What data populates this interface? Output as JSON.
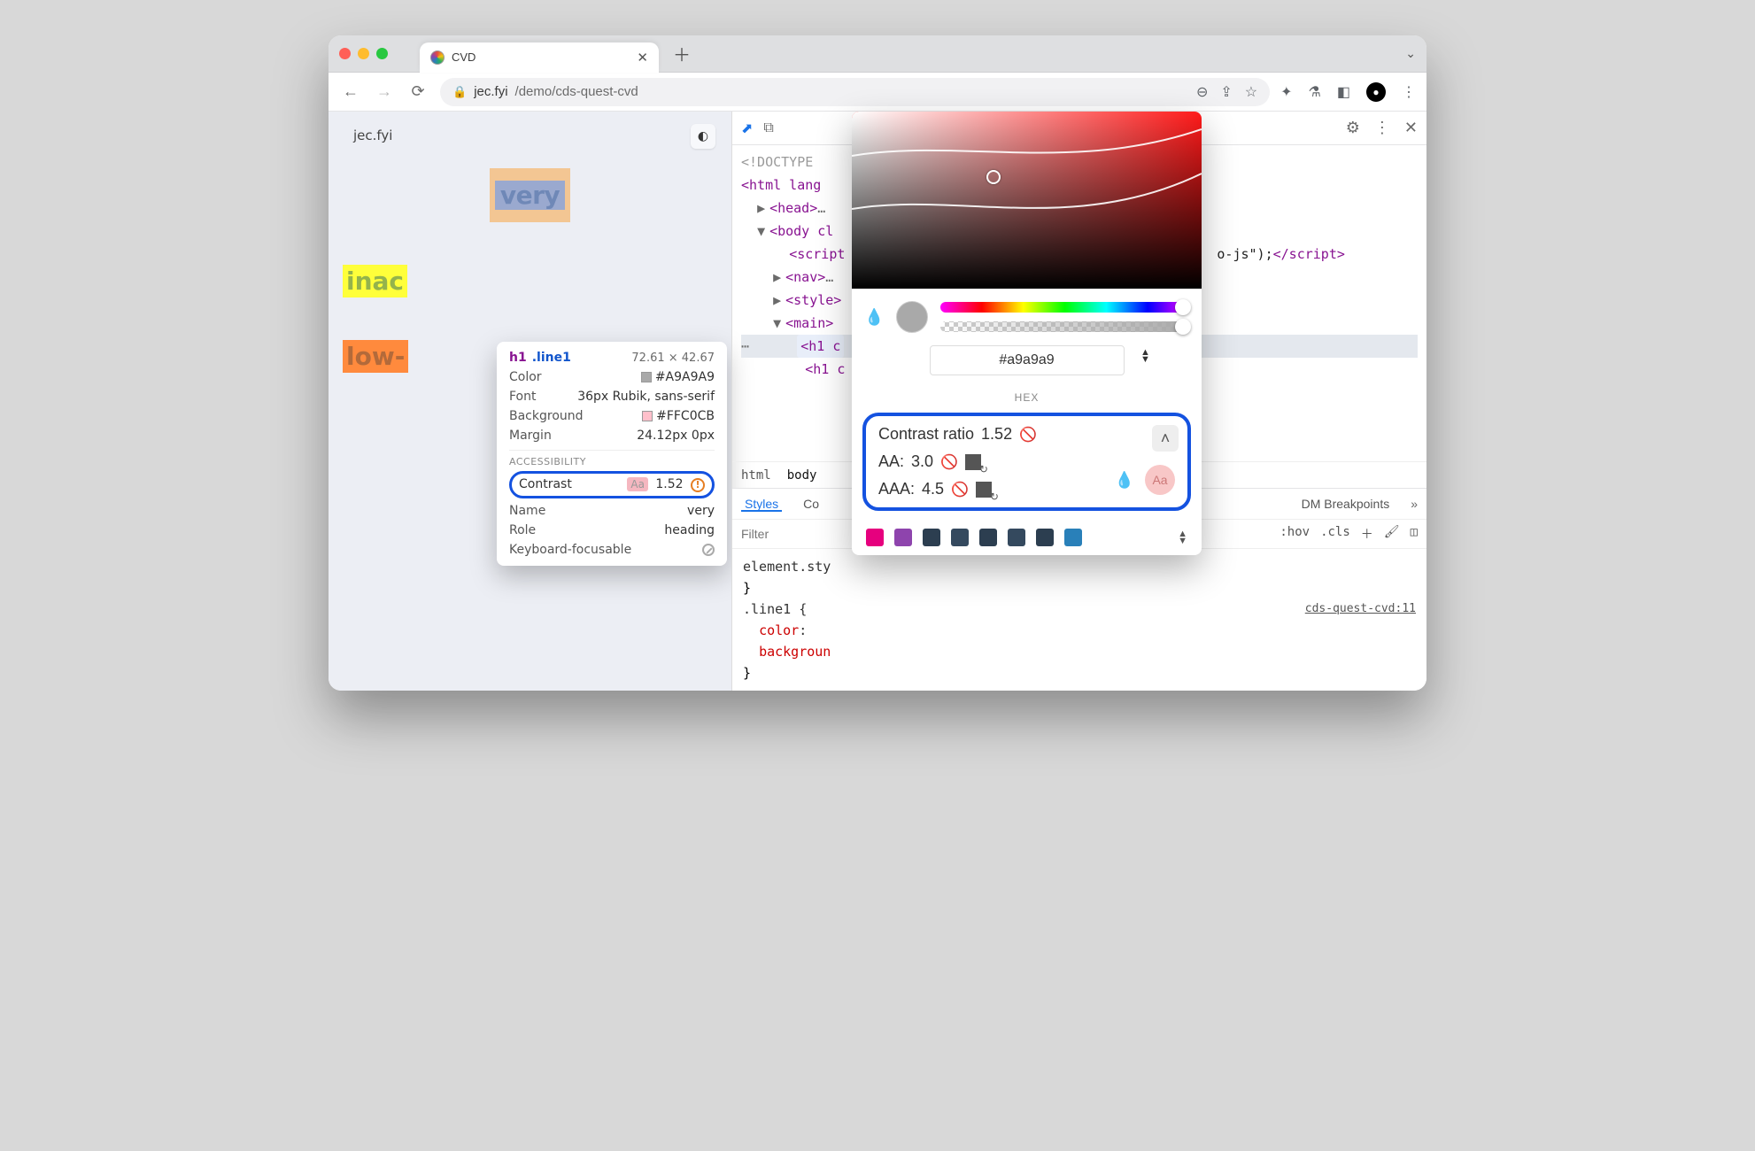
{
  "window": {
    "tab_title": "CVD",
    "url_host": "jec.fyi",
    "url_path": "/demo/cds-quest-cvd"
  },
  "page": {
    "site_name": "jec.fyi",
    "block1_text": "very",
    "block2_text": "inac",
    "block3_text": "low-"
  },
  "tooltip": {
    "tag": "h1",
    "cls": ".line1",
    "dimensions": "72.61 × 42.67",
    "rows": {
      "color_label": "Color",
      "color_value": "#A9A9A9",
      "color_sw": "#A9A9A9",
      "font_label": "Font",
      "font_value": "36px Rubik, sans-serif",
      "bg_label": "Background",
      "bg_value": "#FFC0CB",
      "bg_sw": "#FFC0CB",
      "margin_label": "Margin",
      "margin_value": "24.12px 0px"
    },
    "a11y_label": "ACCESSIBILITY",
    "contrast_label": "Contrast",
    "contrast_chip": "Aa",
    "contrast_value": "1.52",
    "name_label": "Name",
    "name_value": "very",
    "role_label": "Role",
    "role_value": "heading",
    "kb_label": "Keyboard-focusable"
  },
  "devtools": {
    "dom_breakpoints_tab": "DM Breakpoints",
    "more": "»",
    "crumbs": {
      "html": "html",
      "body": "body"
    },
    "side": {
      "styles": "Styles",
      "computed": "Co",
      "filter_placeholder": "Filter",
      "hov": ":hov",
      "cls": ".cls"
    },
    "styles_pane": {
      "element_style": "element.sty",
      "rule": ".line1 {",
      "prop_color": "color",
      "prop_bg": "backgroun",
      "src": "cds-quest-cvd:11"
    },
    "dom_lines": {
      "doctype": "<!DOCTYPE",
      "html": "<html lang",
      "head": "<head>",
      "head_ell": "…",
      "body": "<body cl",
      "script_open": "<script",
      "script_tail": "o-js\");",
      "script_close": "</script>",
      "nav": "<nav>",
      "nav_ell": "…",
      "style": "<style>",
      "main": "<main>",
      "h1a": "<h1 c",
      "h1b": "<h1 c"
    }
  },
  "picker": {
    "hex": "#a9a9a9",
    "hex_label": "HEX",
    "contrast_title": "Contrast ratio",
    "contrast_value": "1.52",
    "aa_label": "AA:",
    "aa_value": "3.0",
    "aaa_label": "AAA:",
    "aaa_value": "4.5",
    "aa_chip": "Aa",
    "palette": [
      "#e6007e",
      "#8e44ad",
      "#2c3e50",
      "#34495e",
      "#2c3e50",
      "#34495e",
      "#2c3e50",
      "#2980b9"
    ]
  }
}
